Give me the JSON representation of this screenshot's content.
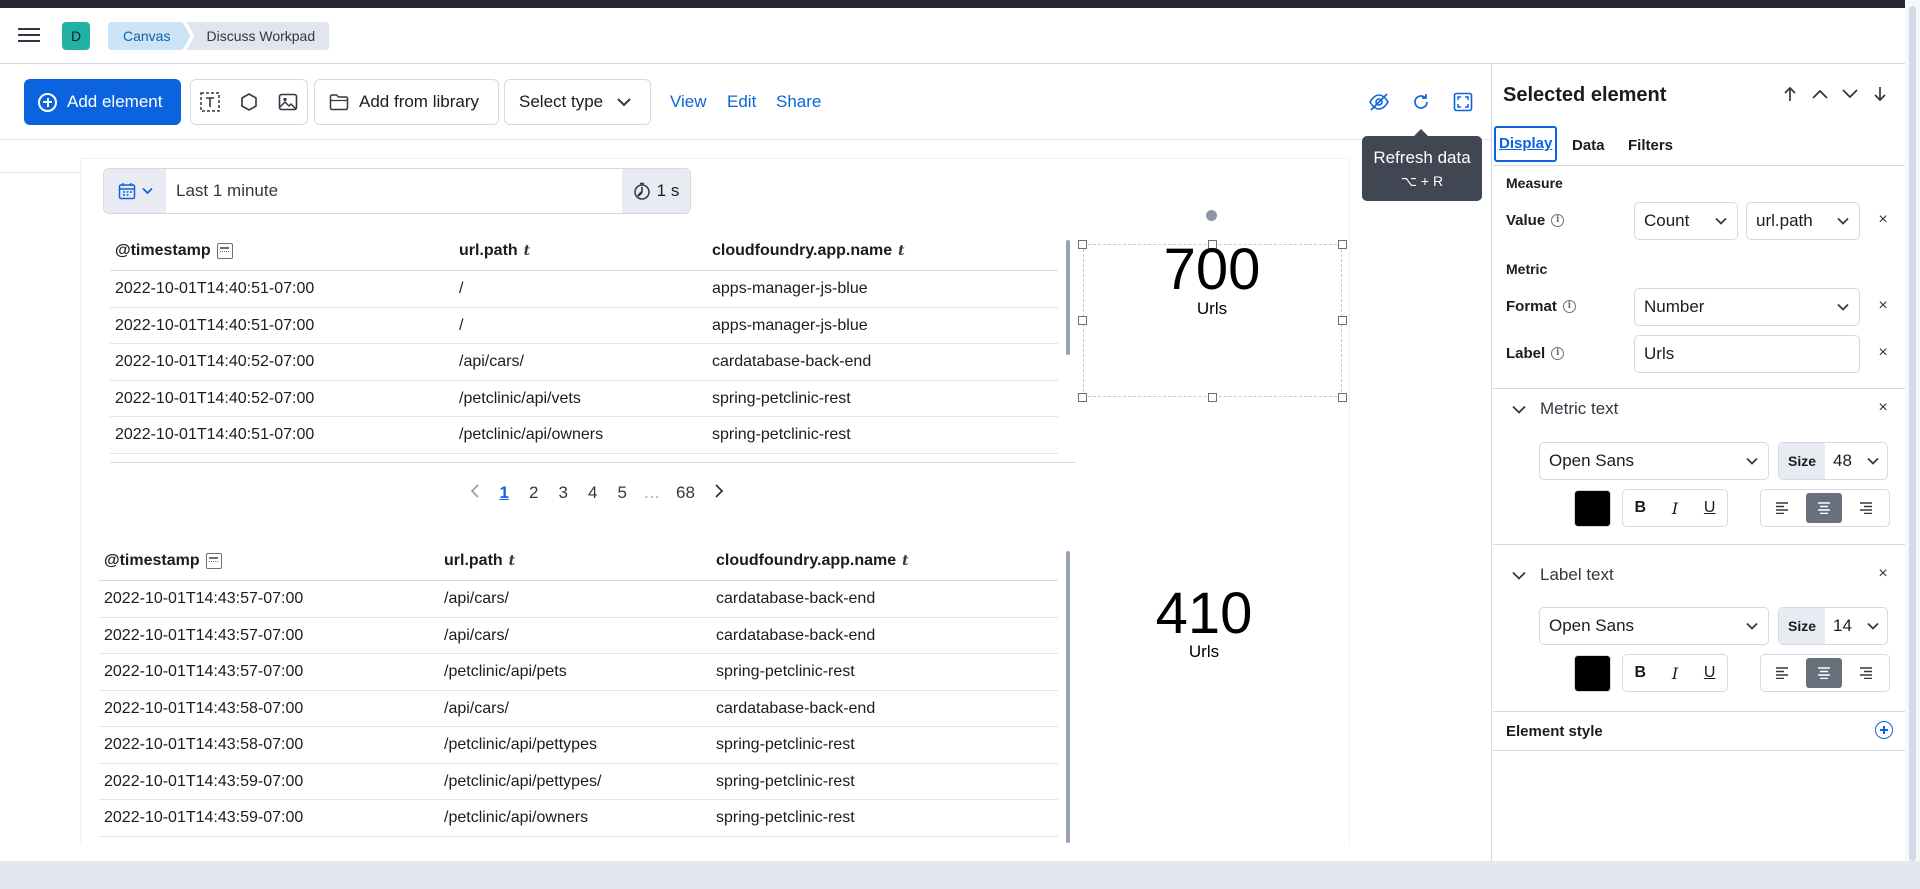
{
  "header": {
    "space_initial": "D",
    "breadcrumbs": [
      "Canvas",
      "Discuss Workpad"
    ]
  },
  "toolbar": {
    "add_element": "Add element",
    "add_from_library": "Add from library",
    "select_type": "Select type",
    "view": "View",
    "edit": "Edit",
    "share": "Share"
  },
  "tooltip": {
    "title": "Refresh data",
    "shortcut": "⌥ + R"
  },
  "time_filter": {
    "range": "Last 1 minute",
    "interval": "1 s"
  },
  "table1": {
    "columns": [
      "@timestamp",
      "url.path",
      "cloudfoundry.app.name"
    ],
    "rows": [
      [
        "2022-10-01T14:40:51-07:00",
        "/",
        "apps-manager-js-blue"
      ],
      [
        "2022-10-01T14:40:51-07:00",
        "/",
        "apps-manager-js-blue"
      ],
      [
        "2022-10-01T14:40:52-07:00",
        "/api/cars/",
        "cardatabase-back-end"
      ],
      [
        "2022-10-01T14:40:52-07:00",
        "/petclinic/api/vets",
        "spring-petclinic-rest"
      ],
      [
        "2022-10-01T14:40:51-07:00",
        "/petclinic/api/owners",
        "spring-petclinic-rest"
      ]
    ]
  },
  "pagination": {
    "pages": [
      "1",
      "2",
      "3",
      "4",
      "5",
      "…",
      "68"
    ],
    "current": "1"
  },
  "table2": {
    "columns": [
      "@timestamp",
      "url.path",
      "cloudfoundry.app.name"
    ],
    "rows": [
      [
        "2022-10-01T14:43:57-07:00",
        "/api/cars/",
        "cardatabase-back-end"
      ],
      [
        "2022-10-01T14:43:57-07:00",
        "/api/cars/",
        "cardatabase-back-end"
      ],
      [
        "2022-10-01T14:43:57-07:00",
        "/petclinic/api/pets",
        "spring-petclinic-rest"
      ],
      [
        "2022-10-01T14:43:58-07:00",
        "/api/cars/",
        "cardatabase-back-end"
      ],
      [
        "2022-10-01T14:43:58-07:00",
        "/petclinic/api/pettypes",
        "spring-petclinic-rest"
      ],
      [
        "2022-10-01T14:43:59-07:00",
        "/petclinic/api/pettypes/",
        "spring-petclinic-rest"
      ],
      [
        "2022-10-01T14:43:59-07:00",
        "/petclinic/api/owners",
        "spring-petclinic-rest"
      ]
    ]
  },
  "metric1": {
    "value": "700",
    "label": "Urls"
  },
  "metric2": {
    "value": "410",
    "label": "Urls"
  },
  "sidebar": {
    "title": "Selected element",
    "tabs": [
      "Display",
      "Data",
      "Filters"
    ],
    "measure_section": "Measure",
    "value_label": "Value",
    "value_function": "Count",
    "value_field": "url.path",
    "metric_section": "Metric",
    "format_label": "Format",
    "format_value": "Number",
    "label_label": "Label",
    "label_value": "Urls",
    "metric_text": {
      "title": "Metric text",
      "font": "Open Sans",
      "size_label": "Size",
      "size": "48"
    },
    "label_text": {
      "title": "Label text",
      "font": "Open Sans",
      "size_label": "Size",
      "size": "14"
    },
    "element_style": "Element style"
  },
  "colors": {
    "primary": "#0b64dd",
    "swatch": "#000000",
    "avatar": "#20b3a4"
  }
}
